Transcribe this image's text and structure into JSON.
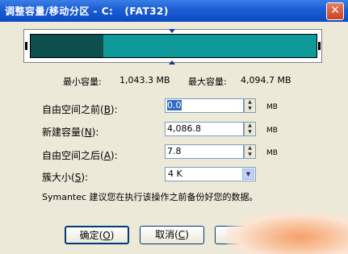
{
  "window": {
    "title": "调整容量/移动分区 - C:   (FAT32)",
    "close_symbol": "✕"
  },
  "sizes": {
    "min_label": "最小容量:",
    "min_value": "1,043.3 MB",
    "max_label": "最大容量:",
    "max_value": "4,094.7 MB"
  },
  "fields": {
    "free_before": {
      "label_pre": "自由空间之前(",
      "hotkey": "B",
      "label_post": "):",
      "value": "0.0",
      "unit": "MB"
    },
    "new_size": {
      "label_pre": "新建容量(",
      "hotkey": "N",
      "label_post": "):",
      "value": "4,086.8",
      "unit": "MB"
    },
    "free_after": {
      "label_pre": "自由空间之后(",
      "hotkey": "A",
      "label_post": "):",
      "value": "7.8",
      "unit": "MB"
    },
    "cluster": {
      "label_pre": "簇大小(",
      "hotkey": "S",
      "label_post": "):",
      "value": "4 K"
    }
  },
  "note": "Symantec 建议您在执行该操作之前备份好您的数据。",
  "buttons": {
    "ok": {
      "label": "确定(",
      "hotkey": "O",
      "post": ")"
    },
    "cancel": {
      "label": "取消(",
      "hotkey": "C",
      "post": ")"
    }
  },
  "icons": {
    "spin_up": "▲",
    "spin_down": "▼",
    "dropdown": "▼"
  }
}
